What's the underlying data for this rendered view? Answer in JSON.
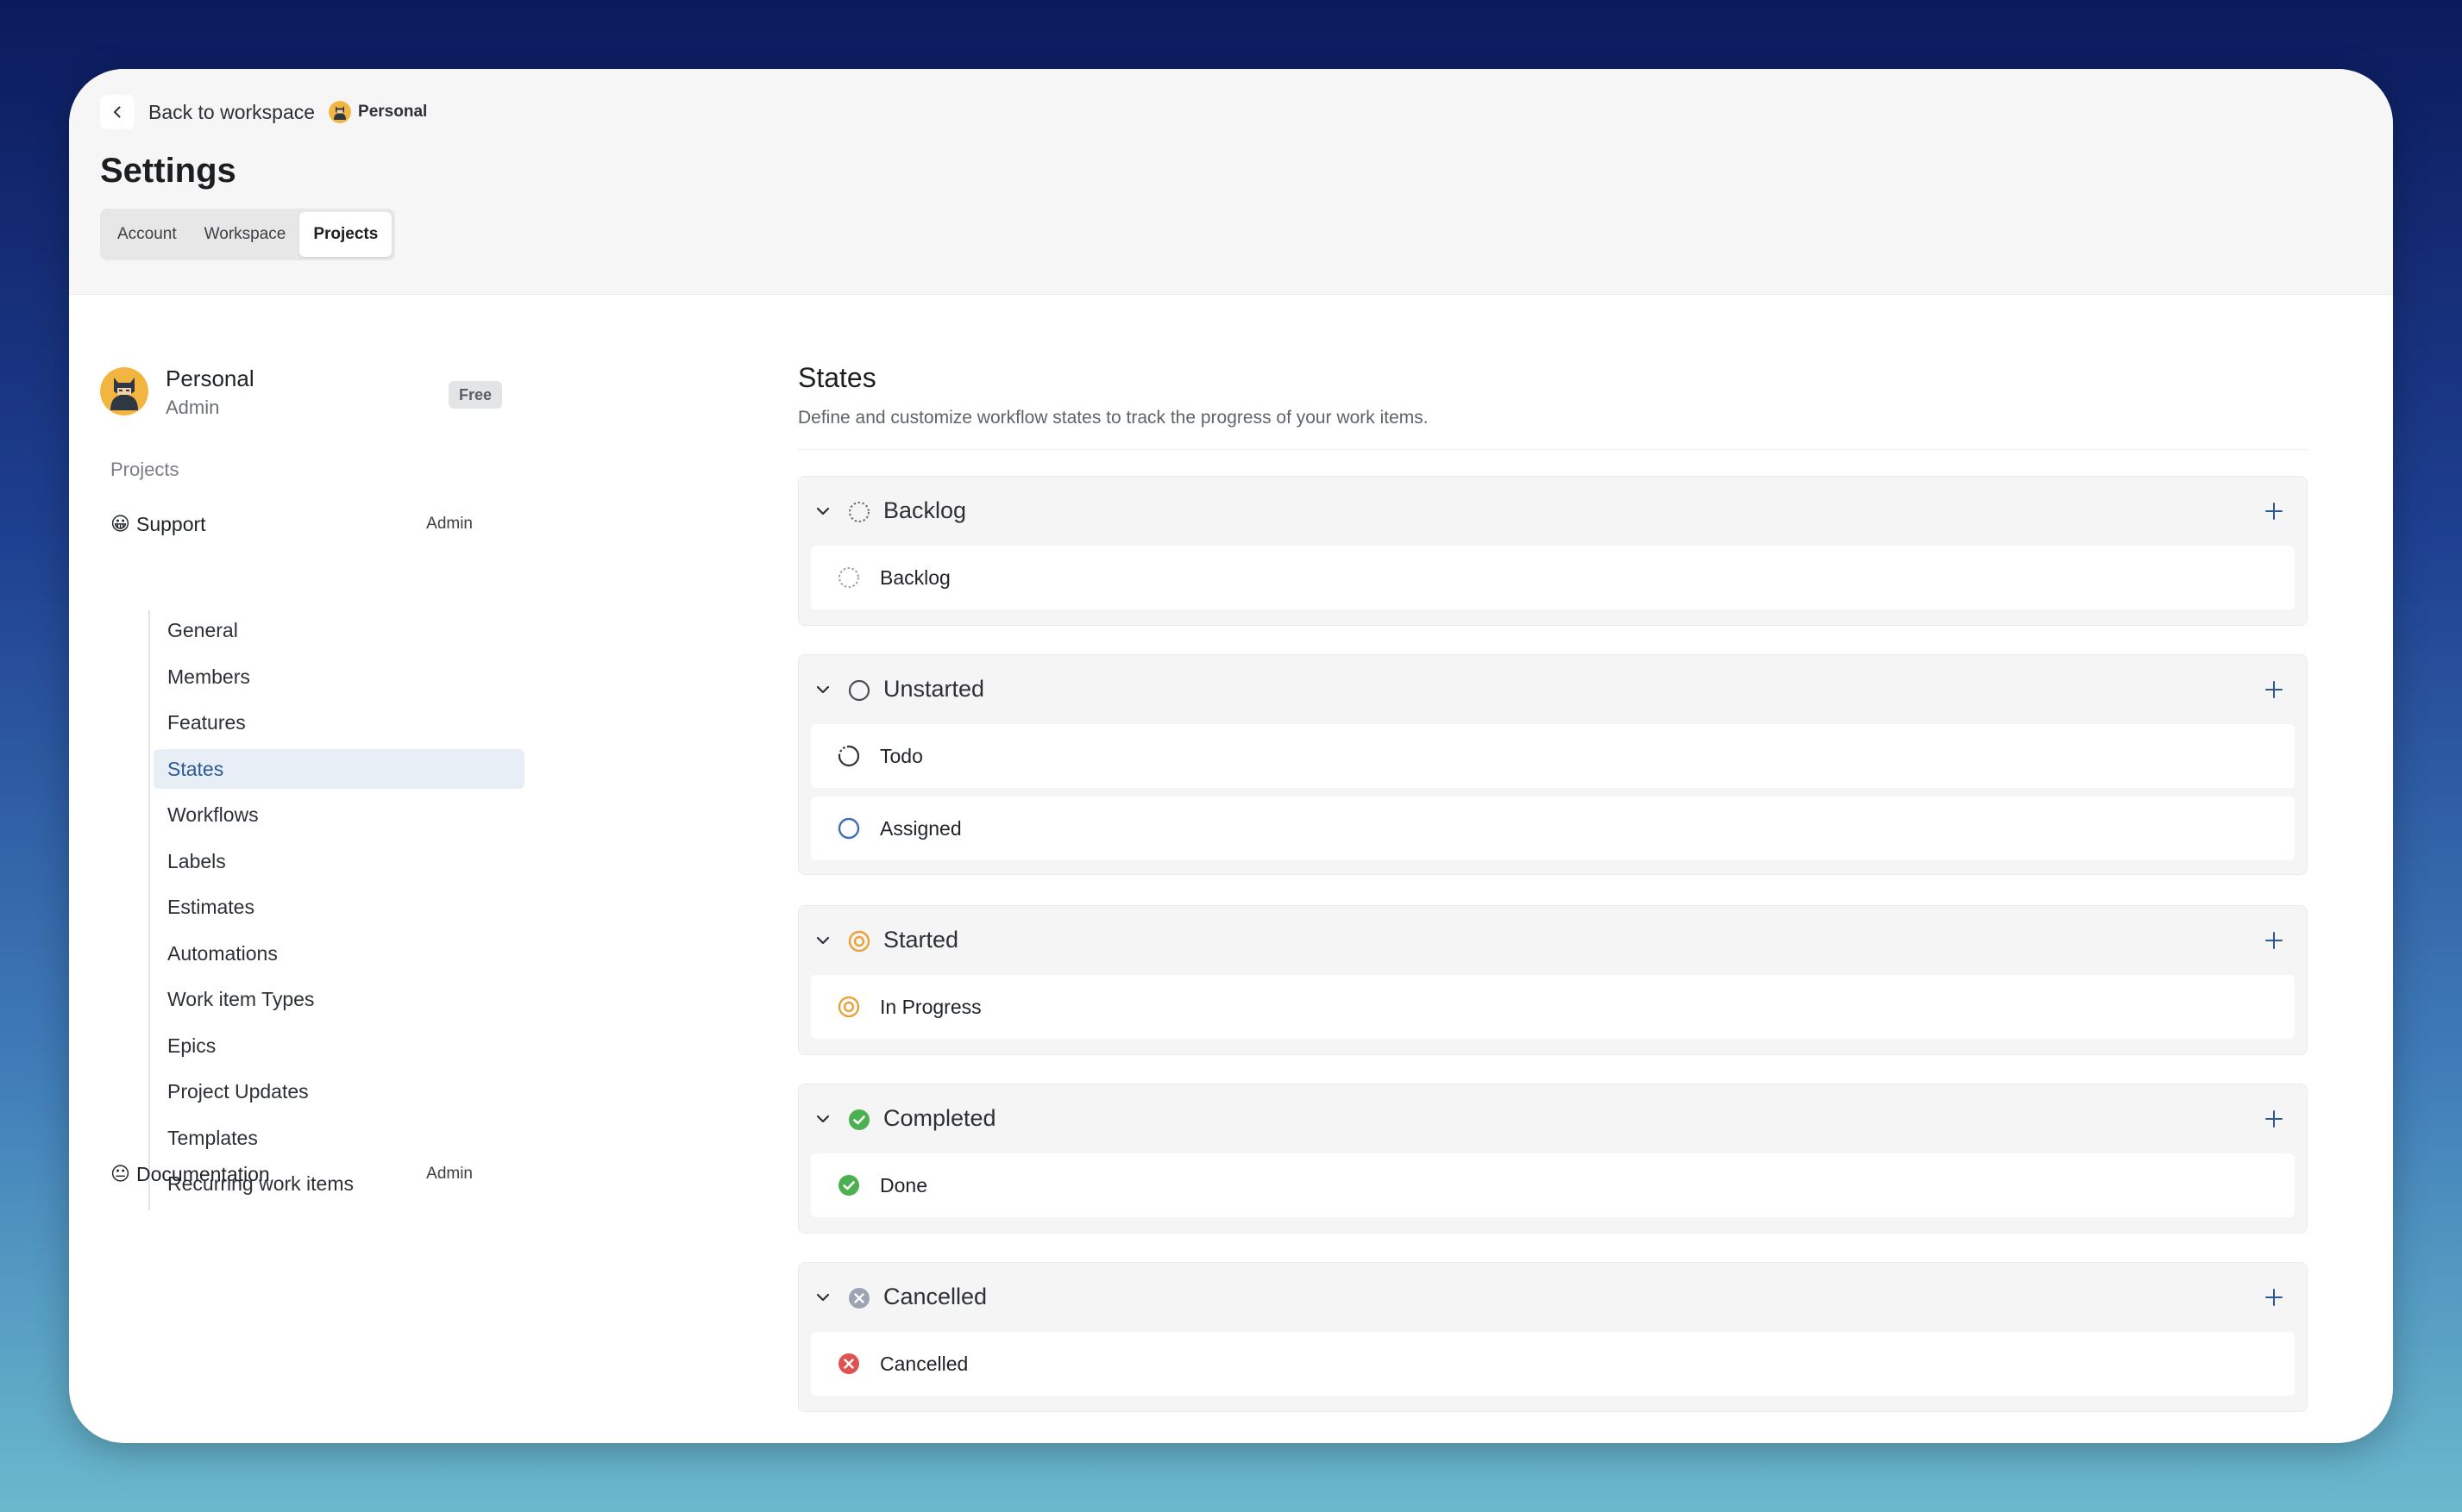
{
  "header": {
    "back_label": "Back to workspace",
    "workspace_name": "Personal",
    "page_title": "Settings",
    "tabs": [
      {
        "label": "Account"
      },
      {
        "label": "Workspace"
      },
      {
        "label": "Projects"
      }
    ],
    "active_tab": "Projects"
  },
  "sidebar": {
    "profile": {
      "name": "Personal",
      "role": "Admin",
      "plan": "Free"
    },
    "section_label": "Projects",
    "projects": [
      {
        "emoji": "😀",
        "name": "Support",
        "role": "Admin"
      },
      {
        "emoji": "😐",
        "name": "Documentation",
        "role": "Admin"
      }
    ],
    "sub_items": [
      {
        "label": "General"
      },
      {
        "label": "Members"
      },
      {
        "label": "Features"
      },
      {
        "label": "States"
      },
      {
        "label": "Workflows"
      },
      {
        "label": "Labels"
      },
      {
        "label": "Estimates"
      },
      {
        "label": "Automations"
      },
      {
        "label": "Work item Types"
      },
      {
        "label": "Epics"
      },
      {
        "label": "Project Updates"
      },
      {
        "label": "Templates"
      },
      {
        "label": "Recurring work items"
      }
    ],
    "active_sub_item": "States"
  },
  "main": {
    "title": "States",
    "description": "Define and customize workflow states to track the progress of your work items.",
    "groups": [
      {
        "title": "Backlog",
        "icon": "backlog-icon",
        "states": [
          {
            "label": "Backlog",
            "icon": "backlog-icon"
          }
        ]
      },
      {
        "title": "Unstarted",
        "icon": "unstarted-icon",
        "states": [
          {
            "label": "Todo",
            "icon": "todo-icon"
          },
          {
            "label": "Assigned",
            "icon": "assigned-icon"
          }
        ]
      },
      {
        "title": "Started",
        "icon": "started-icon",
        "states": [
          {
            "label": "In Progress",
            "icon": "in-progress-icon"
          }
        ]
      },
      {
        "title": "Completed",
        "icon": "completed-icon",
        "states": [
          {
            "label": "Done",
            "icon": "done-icon"
          }
        ]
      },
      {
        "title": "Cancelled",
        "icon": "cancelled-group-icon",
        "states": [
          {
            "label": "Cancelled",
            "icon": "cancelled-icon"
          }
        ]
      }
    ]
  },
  "colors": {
    "accent": "#2b5a93",
    "started": "#e9a23b",
    "completed": "#4caf50",
    "cancelled": "#e05252",
    "cancelled_group": "#9ca3b5",
    "assigned": "#3f6fb5"
  }
}
